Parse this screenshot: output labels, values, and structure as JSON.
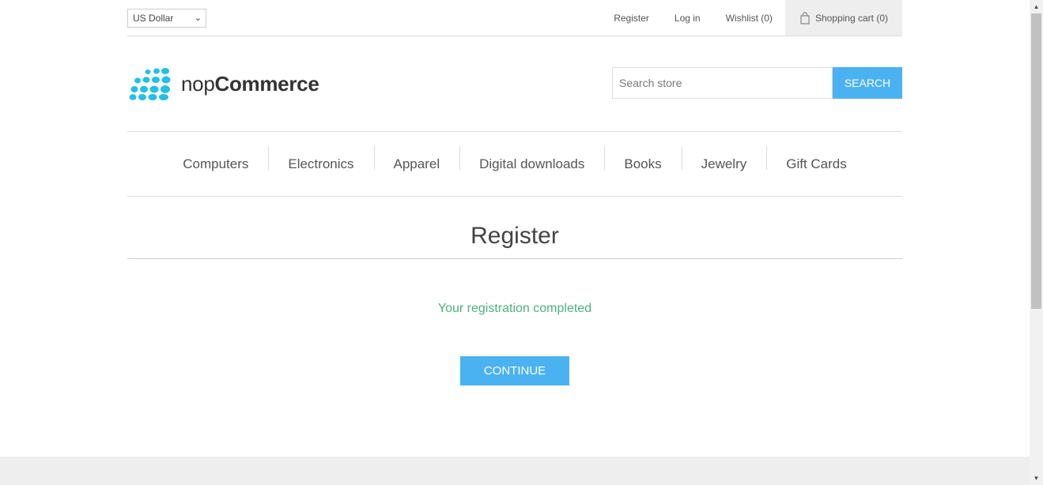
{
  "header": {
    "currency": "US Dollar",
    "links": {
      "register": "Register",
      "login": "Log in",
      "wishlist": "Wishlist (0)",
      "cart": "Shopping cart (0)"
    }
  },
  "logo": {
    "prefix": "nop",
    "suffix": "Commerce"
  },
  "search": {
    "placeholder": "Search store",
    "button": "SEARCH"
  },
  "menu": [
    "Computers",
    "Electronics",
    "Apparel",
    "Digital downloads",
    "Books",
    "Jewelry",
    "Gift Cards"
  ],
  "page": {
    "title": "Register",
    "result": "Your registration completed",
    "continue": "CONTINUE"
  },
  "colors": {
    "accent": "#4ab2f1",
    "success": "#4cb17c",
    "logo": "#22bfe6"
  }
}
